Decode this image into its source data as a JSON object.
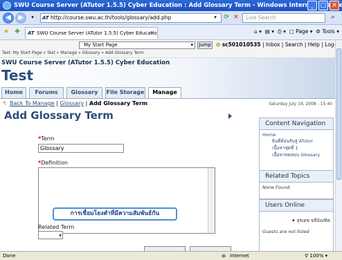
{
  "window": {
    "title": "SWU Course Server (ATutor 1.5.5) Cyber Education : Add Glossary Term - Windows Internet Explorer"
  },
  "browser": {
    "url": "http://course.swu.ac.th/tools/glossary/add.php",
    "search_placeholder": "Live Search",
    "tab_title": "SWU Course Server (ATutor 1.5.5) Cyber Education :...",
    "page_menu": "Page",
    "tools_menu": "Tools"
  },
  "statusbar": {
    "status": "Done",
    "zone": "Internet",
    "zoom": "100%"
  },
  "topbar": {
    "jump_select": "My Start Page",
    "jump_button": "Jump",
    "user": "sc501010535",
    "links": "| Inbox | Search | Help | Log-out",
    "breadcrumb": "Test: My Start Page » Test » Manage » Glossary » Add Glossary Term"
  },
  "header": {
    "site_name": "SWU Course Server (ATutor 1.5.5) Cyber Education",
    "course_title": "Test",
    "tabs": [
      "Home",
      "Forums",
      "Glossary",
      "File Storage",
      "Manage"
    ]
  },
  "subnav": {
    "back_link": "Back To Manage",
    "sep1": "|",
    "glossary_link": "Glossary",
    "sep2": "|",
    "current": "Add Glossary Term",
    "date": "Saturday July 19, 2008 - 15:40"
  },
  "form": {
    "page_title": "Add Glossary Term",
    "term_label": "Term",
    "term_value": "Glossary",
    "definition_label": "Definition",
    "definition_value": "",
    "related_label": "Related Term",
    "required_mark": "*"
  },
  "callout": {
    "text": "การเชื่อมโยงคำที่มีความสัมพันธ์กัน"
  },
  "sidebar": {
    "nav_title": "Content Navigation",
    "nav_home": "Home",
    "nav_items": [
      "ยินดีต้อนรับสู่ ATutor",
      "เนื้อหาชุดที่ 1",
      "เนื้อหาทดสอบ Glossary"
    ],
    "related_title": "Related Topics",
    "related_body": "None Found.",
    "users_title": "Users Online",
    "user_online": "สุรเดช ขจีบัณฑิต",
    "guests_note": "Guests are not listed"
  }
}
